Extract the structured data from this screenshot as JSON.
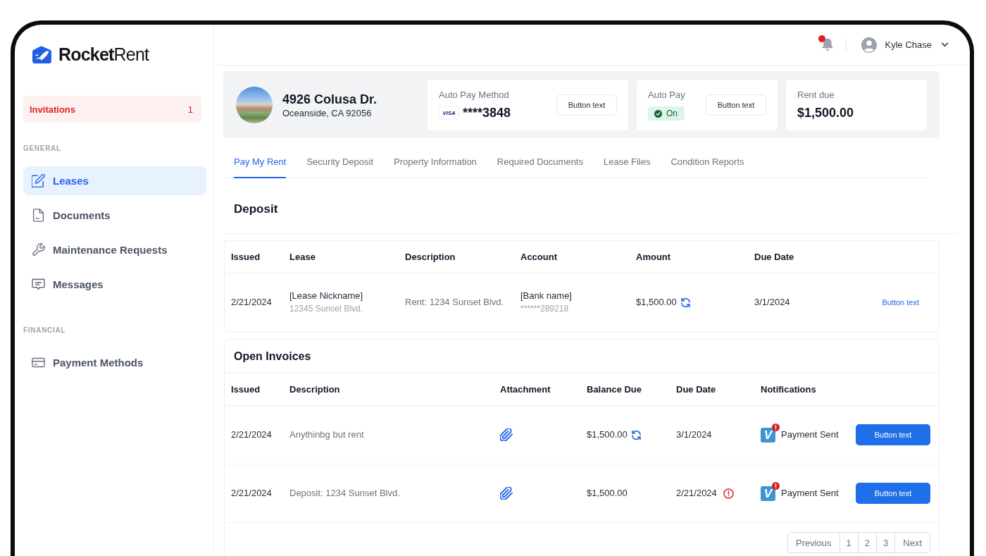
{
  "sidebar": {
    "logo": "**Rocket**Rent",
    "invitations": {
      "label": "Invitations",
      "count": "1"
    },
    "sections": [
      {
        "heading": "GENERAL",
        "items": [
          {
            "label": "Leases",
            "selected": true
          },
          {
            "label": "Documents",
            "selected": false
          },
          {
            "label": "Maintenance Requests",
            "selected": false
          },
          {
            "label": "Messages",
            "selected": false
          }
        ]
      },
      {
        "heading": "FINANCIAL",
        "items": [
          {
            "label": "Payment Methods",
            "selected": false
          }
        ]
      }
    ]
  },
  "header": {
    "notifications": {
      "unread": true
    },
    "user": {
      "name": "Kyle Chase"
    }
  },
  "property": {
    "address": "4926 Colusa Dr.",
    "city": "Oceanside, CA 92056",
    "cards": [
      {
        "kind": "method",
        "label": "Auto Pay Method",
        "brand": "VISA",
        "value": "****3848",
        "button": "Button text"
      },
      {
        "kind": "toggle",
        "label": "Auto Pay",
        "status": "On",
        "on": true,
        "button": "Button text"
      },
      {
        "kind": "amount",
        "label": "Rent due",
        "value": "$1,500.00"
      }
    ]
  },
  "tabs": [
    {
      "label": "Pay My Rent",
      "selected": true
    },
    {
      "label": "Security Deposit",
      "selected": false
    },
    {
      "label": "Property Information",
      "selected": false
    },
    {
      "label": "Required Documents",
      "selected": false
    },
    {
      "label": "Lease Files",
      "selected": false
    },
    {
      "label": "Condition Reports",
      "selected": false
    }
  ],
  "deposit": {
    "title": "Deposit",
    "columns": [
      "Issued",
      "Lease",
      "Description",
      "Account",
      "Amount",
      "Due Date"
    ],
    "rows": [
      {
        "issued": "2/21/2024",
        "lease": "[Lease Nickname]",
        "lease_address": "12345 Sunset Blvd.",
        "description": "Rent: 1234 Sunset Blvd.",
        "account": "[Bank name]",
        "account_number": "******289218",
        "amount": "$1,500.00",
        "recurring": true,
        "due_date": "3/1/2024",
        "action": "Button text"
      }
    ]
  },
  "open_invoices": {
    "title": "Open Invoices",
    "columns": [
      "Issued",
      "Description",
      "Attachment",
      "Balance Due",
      "Due Date",
      "Notifications"
    ],
    "rows": [
      {
        "issued": "2/21/2024",
        "description": "Anythinbg but rent",
        "attachment": true,
        "balance_due": "$1,500.00",
        "recurring": true,
        "due_date": "3/1/2024",
        "overdue": false,
        "notification": {
          "app": "V",
          "text": "Payment Sent",
          "alert": true
        },
        "action": "Button text"
      },
      {
        "issued": "2/21/2024",
        "description": "Deposit: 1234 Sunset Blvd.",
        "attachment": true,
        "balance_due": "$1,500.00",
        "recurring": false,
        "due_date": "2/21/2024",
        "overdue": true,
        "notification": {
          "app": "V",
          "text": "Payment Sent",
          "alert": true
        },
        "action": "Button text"
      }
    ]
  },
  "pagination": {
    "previous": "Previous",
    "pages": [
      {
        "label": "1",
        "selected": false
      },
      {
        "label": "2",
        "selected": false
      },
      {
        "label": "3",
        "selected": false
      }
    ],
    "next": "Next"
  }
}
